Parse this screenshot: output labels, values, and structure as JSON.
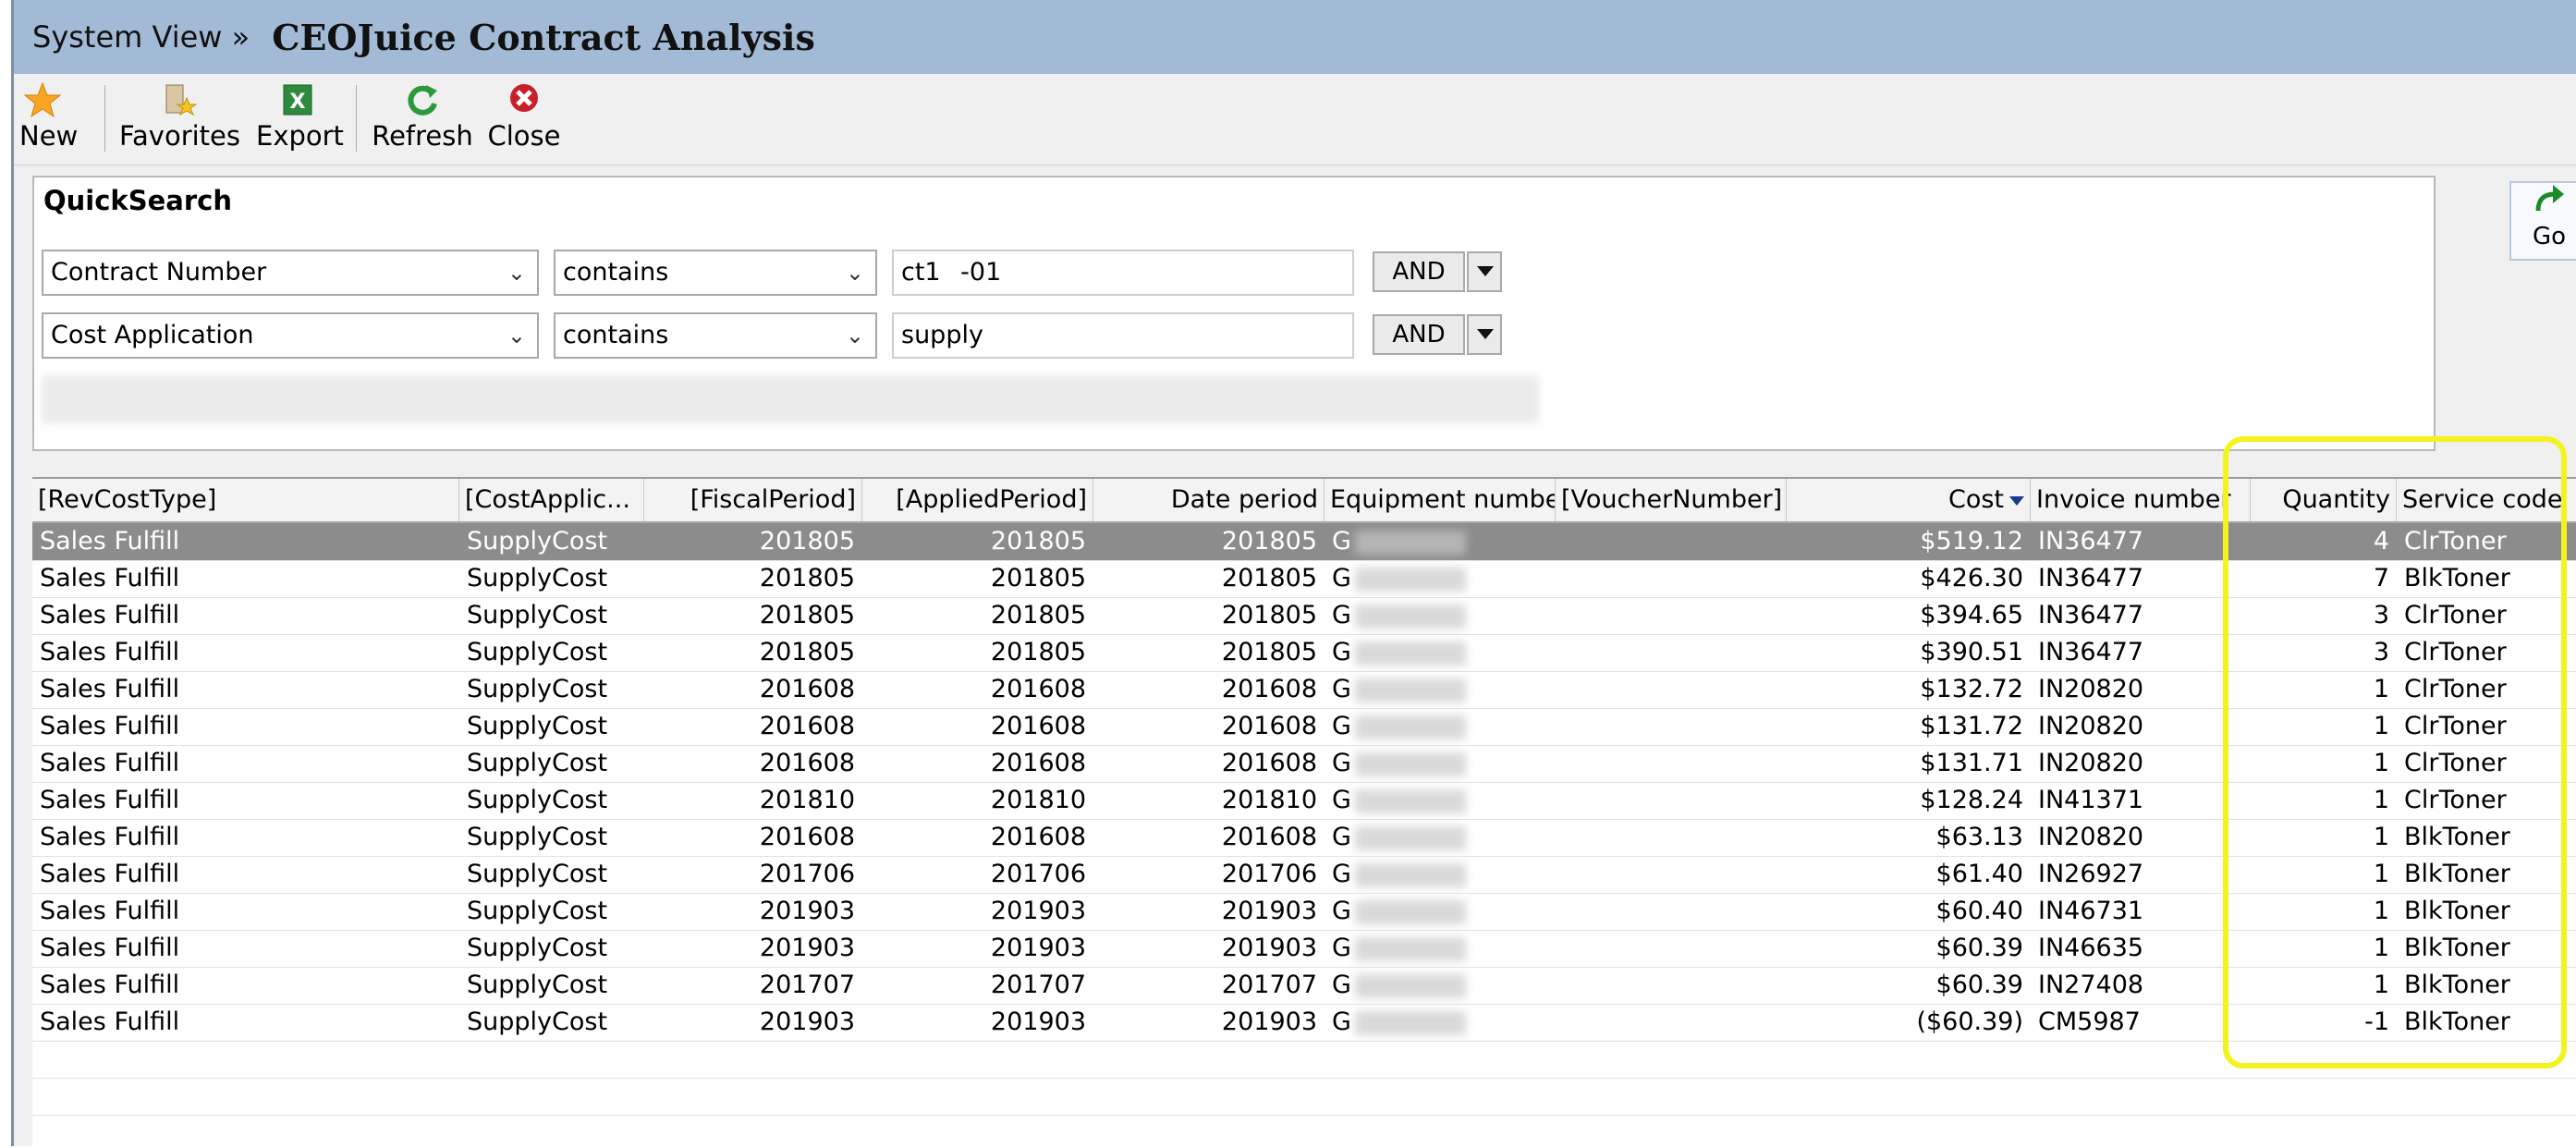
{
  "window": {
    "breadcrumb": "System View »",
    "title": "CEOJuice Contract Analysis"
  },
  "toolbar": {
    "new": "New",
    "favorites": "Favorites",
    "export": "Export",
    "refresh": "Refresh",
    "close": "Close"
  },
  "quicksearch": {
    "header": "QuickSearch",
    "rows": [
      {
        "field": "Contract Number",
        "operator": "contains",
        "value": "ct1    -01",
        "conj": "AND"
      },
      {
        "field": "Cost Application",
        "operator": "contains",
        "value": "supply",
        "conj": "AND"
      }
    ],
    "go": "Go"
  },
  "grid": {
    "columns": [
      "[RevCostType]",
      "[CostApplic...",
      "[FiscalPeriod]",
      "[AppliedPeriod]",
      "Date period",
      "Equipment number",
      "[VoucherNumber]",
      "Cost",
      "Invoice number",
      "Quantity",
      "Service code"
    ],
    "sort_column": "Cost",
    "rows": [
      [
        "Sales Fulfill",
        "SupplyCost",
        "201805",
        "201805",
        "201805",
        "G",
        "",
        "$519.12",
        "IN36477",
        "4",
        "ClrToner"
      ],
      [
        "Sales Fulfill",
        "SupplyCost",
        "201805",
        "201805",
        "201805",
        "G",
        "",
        "$426.30",
        "IN36477",
        "7",
        "BlkToner"
      ],
      [
        "Sales Fulfill",
        "SupplyCost",
        "201805",
        "201805",
        "201805",
        "G",
        "",
        "$394.65",
        "IN36477",
        "3",
        "ClrToner"
      ],
      [
        "Sales Fulfill",
        "SupplyCost",
        "201805",
        "201805",
        "201805",
        "G",
        "",
        "$390.51",
        "IN36477",
        "3",
        "ClrToner"
      ],
      [
        "Sales Fulfill",
        "SupplyCost",
        "201608",
        "201608",
        "201608",
        "G",
        "",
        "$132.72",
        "IN20820",
        "1",
        "ClrToner"
      ],
      [
        "Sales Fulfill",
        "SupplyCost",
        "201608",
        "201608",
        "201608",
        "G",
        "",
        "$131.72",
        "IN20820",
        "1",
        "ClrToner"
      ],
      [
        "Sales Fulfill",
        "SupplyCost",
        "201608",
        "201608",
        "201608",
        "G",
        "",
        "$131.71",
        "IN20820",
        "1",
        "ClrToner"
      ],
      [
        "Sales Fulfill",
        "SupplyCost",
        "201810",
        "201810",
        "201810",
        "G",
        "",
        "$128.24",
        "IN41371",
        "1",
        "ClrToner"
      ],
      [
        "Sales Fulfill",
        "SupplyCost",
        "201608",
        "201608",
        "201608",
        "G",
        "",
        "$63.13",
        "IN20820",
        "1",
        "BlkToner"
      ],
      [
        "Sales Fulfill",
        "SupplyCost",
        "201706",
        "201706",
        "201706",
        "G",
        "",
        "$61.40",
        "IN26927",
        "1",
        "BlkToner"
      ],
      [
        "Sales Fulfill",
        "SupplyCost",
        "201903",
        "201903",
        "201903",
        "G",
        "",
        "$60.40",
        "IN46731",
        "1",
        "BlkToner"
      ],
      [
        "Sales Fulfill",
        "SupplyCost",
        "201903",
        "201903",
        "201903",
        "G",
        "",
        "$60.39",
        "IN46635",
        "1",
        "BlkToner"
      ],
      [
        "Sales Fulfill",
        "SupplyCost",
        "201707",
        "201707",
        "201707",
        "G",
        "",
        "$60.39",
        "IN27408",
        "1",
        "BlkToner"
      ],
      [
        "Sales Fulfill",
        "SupplyCost",
        "201903",
        "201903",
        "201903",
        "G",
        "",
        "($60.39)",
        "CM5987",
        "-1",
        "BlkToner"
      ]
    ]
  },
  "colors": {
    "titlebar": "#a3bad6",
    "selected_row": "#8c8c8c",
    "highlight": "#f3f31e"
  }
}
